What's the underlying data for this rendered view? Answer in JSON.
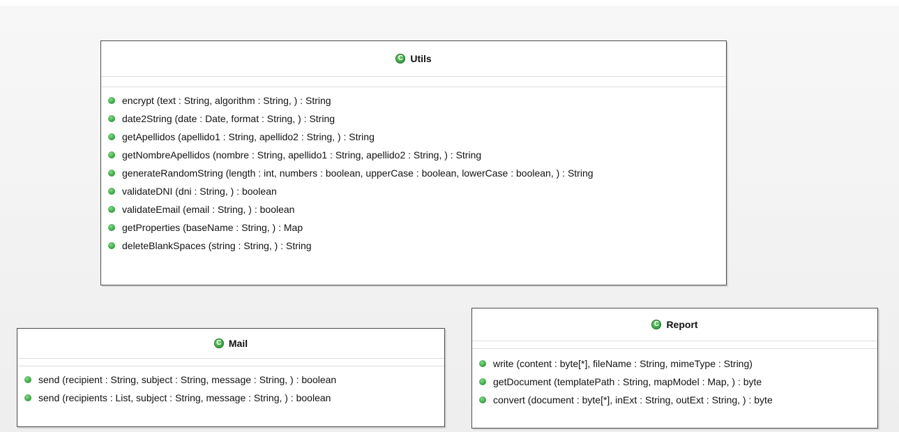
{
  "classes": {
    "utils": {
      "name": "Utils",
      "icon": "class-icon",
      "methods": [
        "encrypt (text : String, algorithm : String, ) : String",
        "date2String (date : Date, format : String, ) : String",
        "getApellidos (apellido1 : String, apellido2 : String, ) : String",
        "getNombreApellidos (nombre : String, apellido1 : String, apellido2 : String, ) : String",
        "generateRandomString (length : int, numbers : boolean, upperCase : boolean, lowerCase : boolean, ) : String",
        "validateDNI (dni : String, ) : boolean",
        "validateEmail (email : String, ) : boolean",
        "getProperties (baseName : String, ) : Map",
        "deleteBlankSpaces (string : String, ) : String"
      ]
    },
    "mail": {
      "name": "Mail",
      "icon": "class-icon",
      "methods": [
        "send (recipient : String, subject : String, message : String, ) : boolean",
        "send (recipients : List, subject : String, message : String, ) : boolean"
      ]
    },
    "report": {
      "name": "Report",
      "icon": "class-icon",
      "methods": [
        "write (content : byte[*], fileName : String, mimeType : String)",
        "getDocument (templatePath : String, mapModel : Map, ) : byte",
        "convert (document : byte[*], inExt : String, outExt : String, ) : byte"
      ]
    }
  },
  "colors": {
    "icon_green": "#2f9a3a",
    "border": "#4a4a4a"
  }
}
